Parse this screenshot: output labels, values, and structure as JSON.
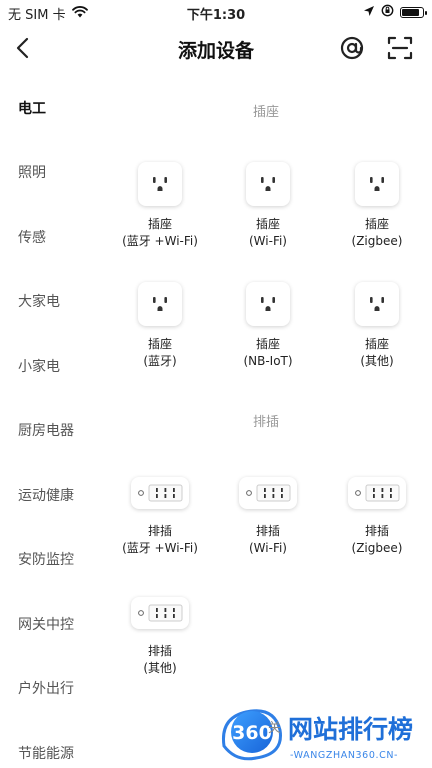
{
  "status_bar": {
    "carrier": "无 SIM 卡",
    "time": "下午1:30",
    "icons": [
      "wifi-icon",
      "location-arrow-icon",
      "rotation-lock-icon",
      "battery-icon"
    ],
    "battery_level": 0.85
  },
  "nav": {
    "title": "添加设备",
    "back_icon": "chevron-left-icon",
    "at_icon": "at-sign-icon",
    "scan_icon": "scan-icon"
  },
  "sidebar": {
    "items": [
      {
        "label": "电工",
        "active": true
      },
      {
        "label": "照明",
        "active": false
      },
      {
        "label": "传感",
        "active": false
      },
      {
        "label": "大家电",
        "active": false
      },
      {
        "label": "小家电",
        "active": false
      },
      {
        "label": "厨房电器",
        "active": false
      },
      {
        "label": "运动健康",
        "active": false
      },
      {
        "label": "安防监控",
        "active": false
      },
      {
        "label": "网关中控",
        "active": false
      },
      {
        "label": "户外出行",
        "active": false
      },
      {
        "label": "节能能源",
        "active": false
      }
    ]
  },
  "sections": {
    "socket": {
      "title": "插座",
      "devices": [
        {
          "name": "插座",
          "sub": "(蓝牙 +Wi-Fi)",
          "icon": "wall-socket-icon"
        },
        {
          "name": "插座",
          "sub": "(Wi-Fi)",
          "icon": "wall-socket-icon"
        },
        {
          "name": "插座",
          "sub": "(Zigbee)",
          "icon": "wall-socket-icon"
        },
        {
          "name": "插座",
          "sub": "(蓝牙)",
          "icon": "wall-socket-icon"
        },
        {
          "name": "插座",
          "sub": "(NB-IoT)",
          "icon": "wall-socket-icon"
        },
        {
          "name": "插座",
          "sub": "(其他)",
          "icon": "wall-socket-icon"
        }
      ]
    },
    "strip": {
      "title": "排插",
      "devices": [
        {
          "name": "排插",
          "sub": "(蓝牙 +Wi-Fi)",
          "icon": "power-strip-icon"
        },
        {
          "name": "排插",
          "sub": "(Wi-Fi)",
          "icon": "power-strip-icon"
        },
        {
          "name": "排插",
          "sub": "(Zigbee)",
          "icon": "power-strip-icon"
        },
        {
          "name": "排插",
          "sub": "(其他)",
          "icon": "power-strip-icon"
        }
      ]
    }
  },
  "watermark": {
    "badge": "360",
    "partial_text": "关",
    "brand": "网站排行榜",
    "url": "-WANGZHAN360.CN-"
  }
}
